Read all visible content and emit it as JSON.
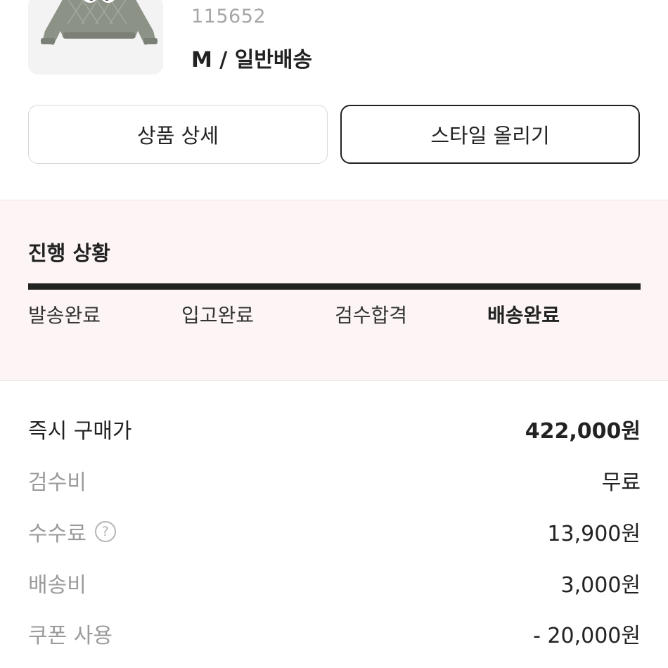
{
  "product": {
    "code": "115652",
    "option": "M / 일반배송",
    "image_icon": "jacket-thumbnail"
  },
  "actions": {
    "detail_label": "상품 상세",
    "style_label": "스타일 올리기"
  },
  "progress": {
    "title": "진행 상황",
    "steps": [
      {
        "label": "발송완료",
        "active": false
      },
      {
        "label": "입고완료",
        "active": false
      },
      {
        "label": "검수합격",
        "active": false
      },
      {
        "label": "배송완료",
        "active": true
      }
    ]
  },
  "price": {
    "rows": [
      {
        "label": "즉시 구매가",
        "value": "422,000원"
      },
      {
        "label": "검수비",
        "value": "무료"
      },
      {
        "label": "수수료",
        "value": "13,900원",
        "help_icon": "?"
      },
      {
        "label": "배송비",
        "value": "3,000원"
      },
      {
        "label": "쿠폰 사용",
        "value": "- 20,000원"
      }
    ]
  },
  "colors": {
    "progress_bg": "#fdf5f5",
    "bar": "#222222",
    "muted_text": "#9a9a9a"
  }
}
